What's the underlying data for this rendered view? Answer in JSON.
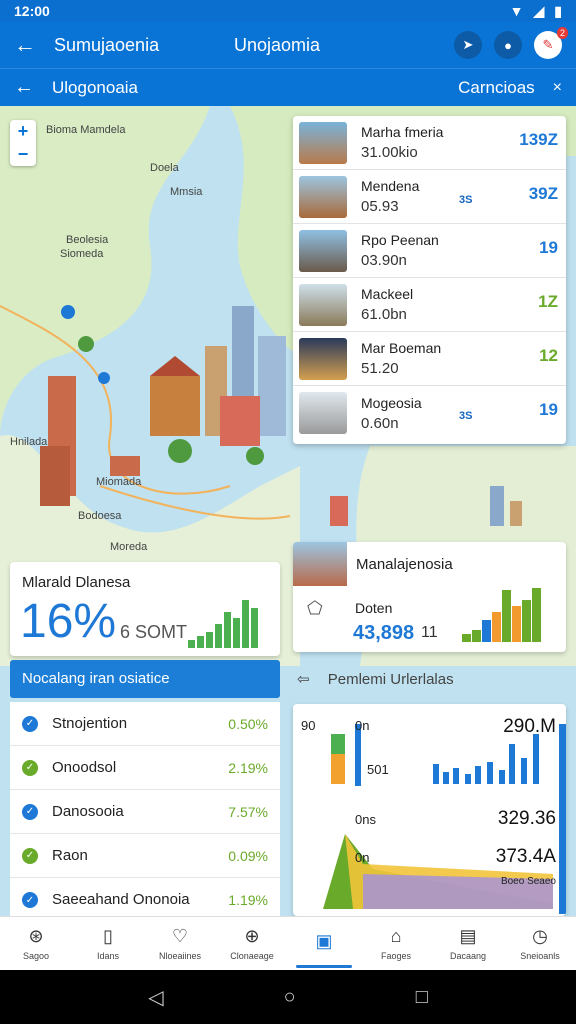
{
  "status": {
    "time": "12:00"
  },
  "appbar": {
    "title_left": "Sumujaoenia",
    "title_center": "Unojaomia",
    "notification_badge": "2"
  },
  "subbar": {
    "title": "Ulogonoaia",
    "action": "Carncioas",
    "close": "×"
  },
  "map": {
    "labels": [
      "Bioma Mamdela",
      "Doela",
      "Mmsia",
      "Beolesia",
      "Siomeda",
      "Hnilada",
      "Miomada",
      "Bodoesa",
      "Moreda"
    ],
    "zoom_in": "+",
    "zoom_out": "−"
  },
  "places": [
    {
      "name": "Marha fmeria",
      "value": "31.00kio",
      "spark": "139Z",
      "spark_color": "#1e78d6",
      "small": ""
    },
    {
      "name": "Mendena",
      "value": "05.93",
      "spark": "39Z",
      "spark_color": "#1e78d6",
      "small": "3S"
    },
    {
      "name": "Rpo Peenan",
      "value": "03.90n",
      "spark": "19",
      "spark_color": "#1e78d6",
      "small": ""
    },
    {
      "name": "Mackeel",
      "value": "61.0bn",
      "spark": "1Z",
      "spark_color": "#6aaa2a",
      "small": ""
    },
    {
      "name": "Mar Boeman",
      "value": "51.20",
      "spark": "12",
      "spark_color": "#6aaa2a",
      "small": ""
    },
    {
      "name": "Mogeosia",
      "value": "0.60n",
      "spark": "19",
      "spark_color": "#1e78d6",
      "small": "3S"
    }
  ],
  "stat_card": {
    "label": "Mlarald Dlanesa",
    "value": "16%",
    "unit": "6 SOMT"
  },
  "section_header": "Nocalang iran osiatice",
  "list": [
    {
      "name": "Stnojention",
      "value": "0.50%",
      "dot_color": "#1e78d6"
    },
    {
      "name": "Onoodsol",
      "value": "2.19%",
      "dot_color": "#6aaa2a"
    },
    {
      "name": "Danosooia",
      "value": "7.57%",
      "dot_color": "#1e78d6"
    },
    {
      "name": "Raon",
      "value": "0.09%",
      "dot_color": "#6aaa2a"
    },
    {
      "name": "Saeeahand Ononoia",
      "value": "1.19%",
      "dot_color": "#1e78d6"
    }
  ],
  "mid_card": {
    "title": "Manalajenosia",
    "subtitle": "Doten",
    "value": "43,898",
    "value2": "11"
  },
  "perf_header": "Pemlemi Urlerlalas",
  "chart_card": {
    "top_left": "90",
    "top_label": "0n",
    "top_value": "290.M",
    "top_mid": "501",
    "bottom_label": "0ns",
    "bottom_value": "329.36",
    "bottom_label2": "0n",
    "bottom_value2": "373.4A",
    "bottom_note": "Boeo Seaeo"
  },
  "bottom_nav": [
    {
      "label": "Sagoo",
      "icon": "compass-icon",
      "glyph": "⊛"
    },
    {
      "label": "Idans",
      "icon": "card-icon",
      "glyph": "▯"
    },
    {
      "label": "Nloeaiines",
      "icon": "heart-icon",
      "glyph": "♡"
    },
    {
      "label": "Clonaeage",
      "icon": "globe-icon",
      "glyph": "⊕"
    },
    {
      "label": "",
      "icon": "dashboard-icon",
      "glyph": "▣"
    },
    {
      "label": "Faoges",
      "icon": "home-icon",
      "glyph": "⌂"
    },
    {
      "label": "Dacaang",
      "icon": "printer-icon",
      "glyph": "▤"
    },
    {
      "label": "Sneioanls",
      "icon": "clock-icon",
      "glyph": "◷"
    }
  ],
  "colors": {
    "primary": "#0a74d6",
    "accent_green": "#6aaa2a",
    "accent_blue": "#1e78d6"
  }
}
